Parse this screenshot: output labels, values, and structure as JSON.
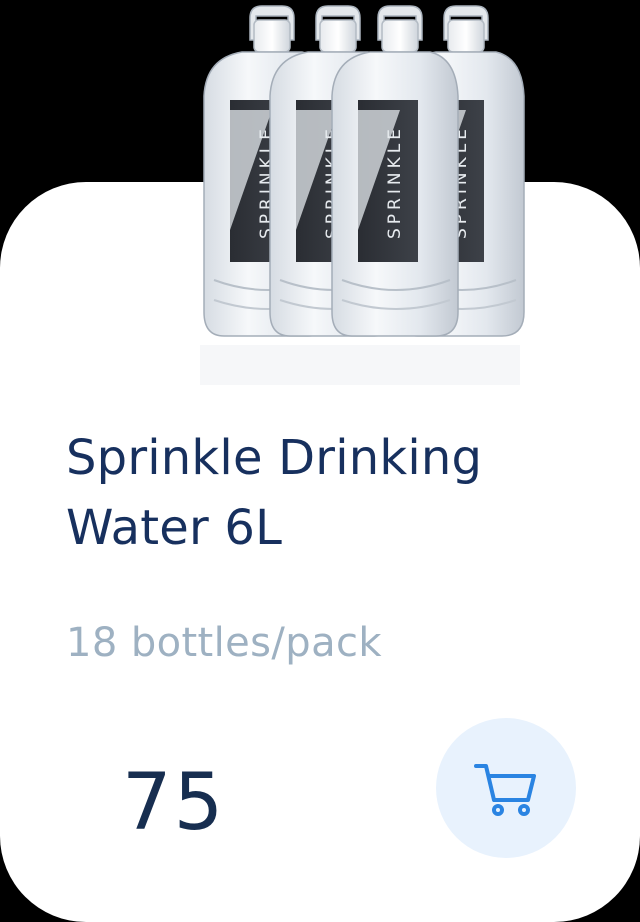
{
  "product": {
    "name": "Sprinkle Drinking Water 6L",
    "pack_info": "18 bottles/pack",
    "price": "75",
    "image_icon": "water-bottle-pack-image",
    "bottle_label": "SPRINKLE"
  },
  "cart_button": {
    "icon": "shopping-cart-icon"
  },
  "colors": {
    "page_background": "#000000",
    "card_background": "#ffffff",
    "title": "#17305e",
    "subtitle": "#9eb1c2",
    "price": "#172e50",
    "cart_button_background": "#e8f2fd",
    "cart_icon": "#2a84e2"
  }
}
